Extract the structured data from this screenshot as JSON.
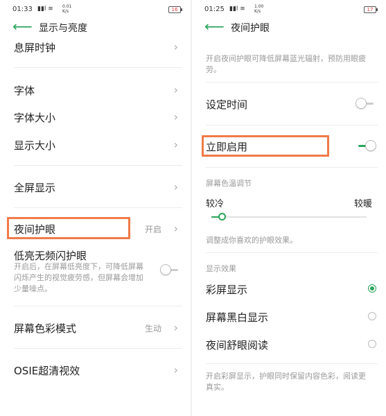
{
  "left": {
    "status": {
      "time": "01:33",
      "signal": "4411 ⌁",
      "speed_top": "0.01",
      "speed_bottom": "K/s",
      "battery": "16"
    },
    "header": {
      "title": "显示与亮度"
    },
    "items": {
      "screen_off_clock": "息屏时钟",
      "font": "字体",
      "font_size": "字体大小",
      "display_size": "显示大小",
      "fullscreen": "全屏显示",
      "night_mode": {
        "label": "夜间护眼",
        "value": "开启"
      },
      "low_brightness": {
        "label": "低亮无频闪护眼",
        "desc": "开启后，在屏幕低亮度下，可降低屏幕闪烁产生的视觉疲劳感，但屏幕会增加少量噪点。",
        "enabled": false
      },
      "color_mode": {
        "label": "屏幕色彩模式",
        "value": "生动"
      },
      "osie": "OSIE超清视效"
    }
  },
  "right": {
    "status": {
      "time": "01:25",
      "signal": "4411 ⌁",
      "speed_top": "1.00",
      "speed_bottom": "K/s",
      "battery": "17"
    },
    "header": {
      "title": "夜间护眼"
    },
    "intro": "开启夜间护眼可降低屏幕蓝光辐射，预防用眼疲劳。",
    "schedule": {
      "label": "设定时间",
      "enabled": false
    },
    "enable_now": {
      "label": "立即启用",
      "enabled": true
    },
    "temperature": {
      "section": "屏幕色温调节",
      "cooler": "较冷",
      "warmer": "较暖",
      "level": 0.05,
      "hint": "调整成你喜欢的护眼效果。"
    },
    "effect": {
      "section": "显示效果",
      "options": [
        {
          "label": "彩屏显示",
          "selected": true
        },
        {
          "label": "屏幕黑白显示",
          "selected": false
        },
        {
          "label": "夜间舒眼阅读",
          "selected": false
        }
      ],
      "note": "开启彩屏显示，护眼同时保留内容色彩，阅读更真实。"
    }
  },
  "colors": {
    "accent": "#2aa35b",
    "highlight": "#f07a48",
    "muted_text": "#9a9a9a"
  },
  "icons": {
    "back": "back-arrow-icon",
    "chevron": "chevron-right-icon"
  }
}
